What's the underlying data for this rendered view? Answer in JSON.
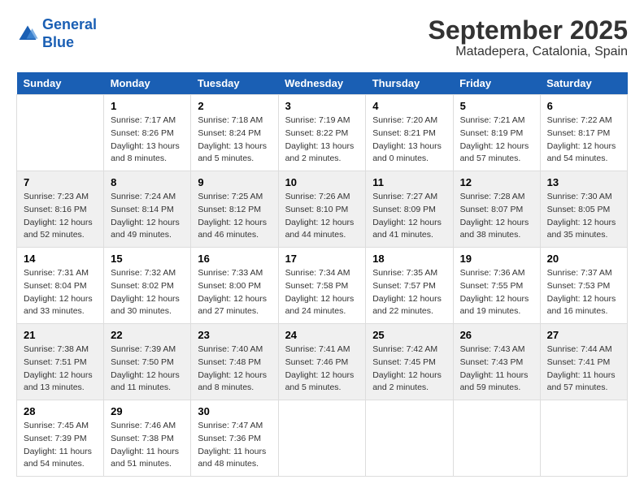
{
  "logo": {
    "line1": "General",
    "line2": "Blue"
  },
  "title": "September 2025",
  "location": "Matadepera, Catalonia, Spain",
  "weekdays": [
    "Sunday",
    "Monday",
    "Tuesday",
    "Wednesday",
    "Thursday",
    "Friday",
    "Saturday"
  ],
  "weeks": [
    [
      {
        "day": "",
        "info": ""
      },
      {
        "day": "1",
        "info": "Sunrise: 7:17 AM\nSunset: 8:26 PM\nDaylight: 13 hours\nand 8 minutes."
      },
      {
        "day": "2",
        "info": "Sunrise: 7:18 AM\nSunset: 8:24 PM\nDaylight: 13 hours\nand 5 minutes."
      },
      {
        "day": "3",
        "info": "Sunrise: 7:19 AM\nSunset: 8:22 PM\nDaylight: 13 hours\nand 2 minutes."
      },
      {
        "day": "4",
        "info": "Sunrise: 7:20 AM\nSunset: 8:21 PM\nDaylight: 13 hours\nand 0 minutes."
      },
      {
        "day": "5",
        "info": "Sunrise: 7:21 AM\nSunset: 8:19 PM\nDaylight: 12 hours\nand 57 minutes."
      },
      {
        "day": "6",
        "info": "Sunrise: 7:22 AM\nSunset: 8:17 PM\nDaylight: 12 hours\nand 54 minutes."
      }
    ],
    [
      {
        "day": "7",
        "info": "Sunrise: 7:23 AM\nSunset: 8:16 PM\nDaylight: 12 hours\nand 52 minutes."
      },
      {
        "day": "8",
        "info": "Sunrise: 7:24 AM\nSunset: 8:14 PM\nDaylight: 12 hours\nand 49 minutes."
      },
      {
        "day": "9",
        "info": "Sunrise: 7:25 AM\nSunset: 8:12 PM\nDaylight: 12 hours\nand 46 minutes."
      },
      {
        "day": "10",
        "info": "Sunrise: 7:26 AM\nSunset: 8:10 PM\nDaylight: 12 hours\nand 44 minutes."
      },
      {
        "day": "11",
        "info": "Sunrise: 7:27 AM\nSunset: 8:09 PM\nDaylight: 12 hours\nand 41 minutes."
      },
      {
        "day": "12",
        "info": "Sunrise: 7:28 AM\nSunset: 8:07 PM\nDaylight: 12 hours\nand 38 minutes."
      },
      {
        "day": "13",
        "info": "Sunrise: 7:30 AM\nSunset: 8:05 PM\nDaylight: 12 hours\nand 35 minutes."
      }
    ],
    [
      {
        "day": "14",
        "info": "Sunrise: 7:31 AM\nSunset: 8:04 PM\nDaylight: 12 hours\nand 33 minutes."
      },
      {
        "day": "15",
        "info": "Sunrise: 7:32 AM\nSunset: 8:02 PM\nDaylight: 12 hours\nand 30 minutes."
      },
      {
        "day": "16",
        "info": "Sunrise: 7:33 AM\nSunset: 8:00 PM\nDaylight: 12 hours\nand 27 minutes."
      },
      {
        "day": "17",
        "info": "Sunrise: 7:34 AM\nSunset: 7:58 PM\nDaylight: 12 hours\nand 24 minutes."
      },
      {
        "day": "18",
        "info": "Sunrise: 7:35 AM\nSunset: 7:57 PM\nDaylight: 12 hours\nand 22 minutes."
      },
      {
        "day": "19",
        "info": "Sunrise: 7:36 AM\nSunset: 7:55 PM\nDaylight: 12 hours\nand 19 minutes."
      },
      {
        "day": "20",
        "info": "Sunrise: 7:37 AM\nSunset: 7:53 PM\nDaylight: 12 hours\nand 16 minutes."
      }
    ],
    [
      {
        "day": "21",
        "info": "Sunrise: 7:38 AM\nSunset: 7:51 PM\nDaylight: 12 hours\nand 13 minutes."
      },
      {
        "day": "22",
        "info": "Sunrise: 7:39 AM\nSunset: 7:50 PM\nDaylight: 12 hours\nand 11 minutes."
      },
      {
        "day": "23",
        "info": "Sunrise: 7:40 AM\nSunset: 7:48 PM\nDaylight: 12 hours\nand 8 minutes."
      },
      {
        "day": "24",
        "info": "Sunrise: 7:41 AM\nSunset: 7:46 PM\nDaylight: 12 hours\nand 5 minutes."
      },
      {
        "day": "25",
        "info": "Sunrise: 7:42 AM\nSunset: 7:45 PM\nDaylight: 12 hours\nand 2 minutes."
      },
      {
        "day": "26",
        "info": "Sunrise: 7:43 AM\nSunset: 7:43 PM\nDaylight: 11 hours\nand 59 minutes."
      },
      {
        "day": "27",
        "info": "Sunrise: 7:44 AM\nSunset: 7:41 PM\nDaylight: 11 hours\nand 57 minutes."
      }
    ],
    [
      {
        "day": "28",
        "info": "Sunrise: 7:45 AM\nSunset: 7:39 PM\nDaylight: 11 hours\nand 54 minutes."
      },
      {
        "day": "29",
        "info": "Sunrise: 7:46 AM\nSunset: 7:38 PM\nDaylight: 11 hours\nand 51 minutes."
      },
      {
        "day": "30",
        "info": "Sunrise: 7:47 AM\nSunset: 7:36 PM\nDaylight: 11 hours\nand 48 minutes."
      },
      {
        "day": "",
        "info": ""
      },
      {
        "day": "",
        "info": ""
      },
      {
        "day": "",
        "info": ""
      },
      {
        "day": "",
        "info": ""
      }
    ]
  ]
}
